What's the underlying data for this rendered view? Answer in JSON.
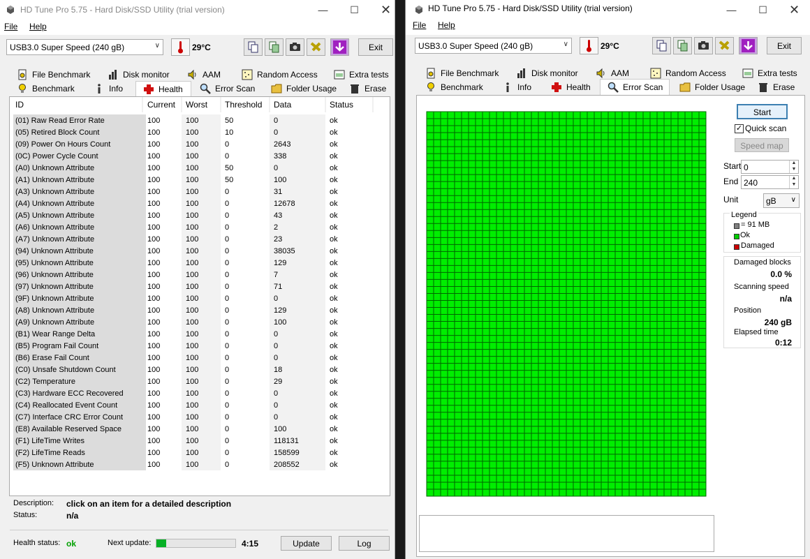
{
  "left": {
    "title": "HD Tune Pro 5.75 - Hard Disk/SSD Utility (trial version)",
    "menu": [
      {
        "label": "File"
      },
      {
        "label": "Help"
      }
    ],
    "drive": "USB3.0  Super Speed (240 gB)",
    "temperature": "29°C",
    "exit_label": "Exit",
    "tabs_row1": [
      "File Benchmark",
      "Disk monitor",
      "AAM",
      "Random Access",
      "Extra tests"
    ],
    "tabs_row2": [
      "Benchmark",
      "Info",
      "Health",
      "Error Scan",
      "Folder Usage",
      "Erase"
    ],
    "active_tab": "Health",
    "health_table": {
      "columns": [
        "ID",
        "Current",
        "Worst",
        "Threshold",
        "Data",
        "Status"
      ],
      "rows": [
        [
          "(01) Raw Read Error Rate",
          "100",
          "100",
          "50",
          "0",
          "ok"
        ],
        [
          "(05) Retired Block Count",
          "100",
          "100",
          "10",
          "0",
          "ok"
        ],
        [
          "(09) Power On Hours Count",
          "100",
          "100",
          "0",
          "2643",
          "ok"
        ],
        [
          "(0C) Power Cycle Count",
          "100",
          "100",
          "0",
          "338",
          "ok"
        ],
        [
          "(A0) Unknown Attribute",
          "100",
          "100",
          "50",
          "0",
          "ok"
        ],
        [
          "(A1) Unknown Attribute",
          "100",
          "100",
          "50",
          "100",
          "ok"
        ],
        [
          "(A3) Unknown Attribute",
          "100",
          "100",
          "0",
          "31",
          "ok"
        ],
        [
          "(A4) Unknown Attribute",
          "100",
          "100",
          "0",
          "12678",
          "ok"
        ],
        [
          "(A5) Unknown Attribute",
          "100",
          "100",
          "0",
          "43",
          "ok"
        ],
        [
          "(A6) Unknown Attribute",
          "100",
          "100",
          "0",
          "2",
          "ok"
        ],
        [
          "(A7) Unknown Attribute",
          "100",
          "100",
          "0",
          "23",
          "ok"
        ],
        [
          "(94) Unknown Attribute",
          "100",
          "100",
          "0",
          "38035",
          "ok"
        ],
        [
          "(95) Unknown Attribute",
          "100",
          "100",
          "0",
          "129",
          "ok"
        ],
        [
          "(96) Unknown Attribute",
          "100",
          "100",
          "0",
          "7",
          "ok"
        ],
        [
          "(97) Unknown Attribute",
          "100",
          "100",
          "0",
          "71",
          "ok"
        ],
        [
          "(9F) Unknown Attribute",
          "100",
          "100",
          "0",
          "0",
          "ok"
        ],
        [
          "(A8) Unknown Attribute",
          "100",
          "100",
          "0",
          "129",
          "ok"
        ],
        [
          "(A9) Unknown Attribute",
          "100",
          "100",
          "0",
          "100",
          "ok"
        ],
        [
          "(B1) Wear Range Delta",
          "100",
          "100",
          "0",
          "0",
          "ok"
        ],
        [
          "(B5) Program Fail Count",
          "100",
          "100",
          "0",
          "0",
          "ok"
        ],
        [
          "(B6) Erase Fail Count",
          "100",
          "100",
          "0",
          "0",
          "ok"
        ],
        [
          "(C0) Unsafe Shutdown Count",
          "100",
          "100",
          "0",
          "18",
          "ok"
        ],
        [
          "(C2) Temperature",
          "100",
          "100",
          "0",
          "29",
          "ok"
        ],
        [
          "(C3) Hardware ECC Recovered",
          "100",
          "100",
          "0",
          "0",
          "ok"
        ],
        [
          "(C4) Reallocated Event Count",
          "100",
          "100",
          "0",
          "0",
          "ok"
        ],
        [
          "(C7) Interface CRC Error Count",
          "100",
          "100",
          "0",
          "0",
          "ok"
        ],
        [
          "(E8) Available Reserved Space",
          "100",
          "100",
          "0",
          "100",
          "ok"
        ],
        [
          "(F1) LifeTime Writes",
          "100",
          "100",
          "0",
          "118131",
          "ok"
        ],
        [
          "(F2) LifeTime Reads",
          "100",
          "100",
          "0",
          "158599",
          "ok"
        ],
        [
          "(F5) Unknown Attribute",
          "100",
          "100",
          "0",
          "208552",
          "ok"
        ]
      ]
    },
    "description_label": "Description:",
    "description_value": "click on an item for a detailed description",
    "status_label": "Status:",
    "status_value": "n/a",
    "health_status_label": "Health status:",
    "health_status_value": "ok",
    "next_update_label": "Next update:",
    "next_update_progress": 0.12,
    "next_update_time": "4:15",
    "update_label": "Update",
    "log_label": "Log"
  },
  "right": {
    "title": "HD Tune Pro 5.75 - Hard Disk/SSD Utility (trial version)",
    "menu": [
      {
        "label": "File"
      },
      {
        "label": "Help"
      }
    ],
    "drive": "USB3.0  Super Speed (240 gB)",
    "temperature": "29°C",
    "exit_label": "Exit",
    "tabs_row1": [
      "File Benchmark",
      "Disk monitor",
      "AAM",
      "Random Access",
      "Extra tests"
    ],
    "tabs_row2": [
      "Benchmark",
      "Info",
      "Health",
      "Error Scan",
      "Folder Usage",
      "Erase"
    ],
    "active_tab": "Error Scan",
    "start_label": "Start",
    "quick_scan_label": "Quick scan",
    "quick_scan_checked": true,
    "speed_map_label": "Speed map",
    "start_field_label": "Start",
    "start_value": "0",
    "end_field_label": "End",
    "end_value": "240",
    "unit_label": "Unit",
    "unit_value": "gB",
    "legend_title": "Legend",
    "legend": [
      {
        "label": "= 91 MB",
        "color": "#808080"
      },
      {
        "label": "Ok",
        "color": "#00cc00"
      },
      {
        "label": "Damaged",
        "color": "#cc0000"
      }
    ],
    "damaged_blocks_label": "Damaged blocks",
    "damaged_blocks_value": "0.0 %",
    "scanning_speed_label": "Scanning speed",
    "scanning_speed_value": "n/a",
    "position_label": "Position",
    "position_value": "240 gB",
    "elapsed_label": "Elapsed time",
    "elapsed_value": "0:12",
    "scan_block_color": "#00ee00",
    "scan_grid_color": "#006600"
  }
}
